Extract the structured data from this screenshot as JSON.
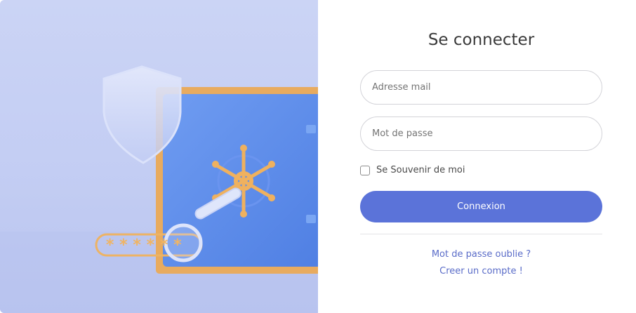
{
  "login": {
    "title": "Se connecter",
    "email_placeholder": "Adresse mail",
    "password_placeholder": "Mot de passe",
    "remember_label": "Se Souvenir de moi",
    "remember_checked": false,
    "submit_label": "Connexion",
    "forgot_link": "Mot de passe oublie ?",
    "create_link": "Creer un compte !"
  },
  "illustration": {
    "password_mask": "******",
    "icons": [
      "shield-icon",
      "safe-icon",
      "safe-wheel-icon",
      "magnifier-icon"
    ]
  },
  "colors": {
    "accent": "#5b73d9",
    "link": "#5a6cc8",
    "safe_body": "#5b8ded",
    "safe_frame": "#e7a95d",
    "background": "#c3cdf3"
  }
}
